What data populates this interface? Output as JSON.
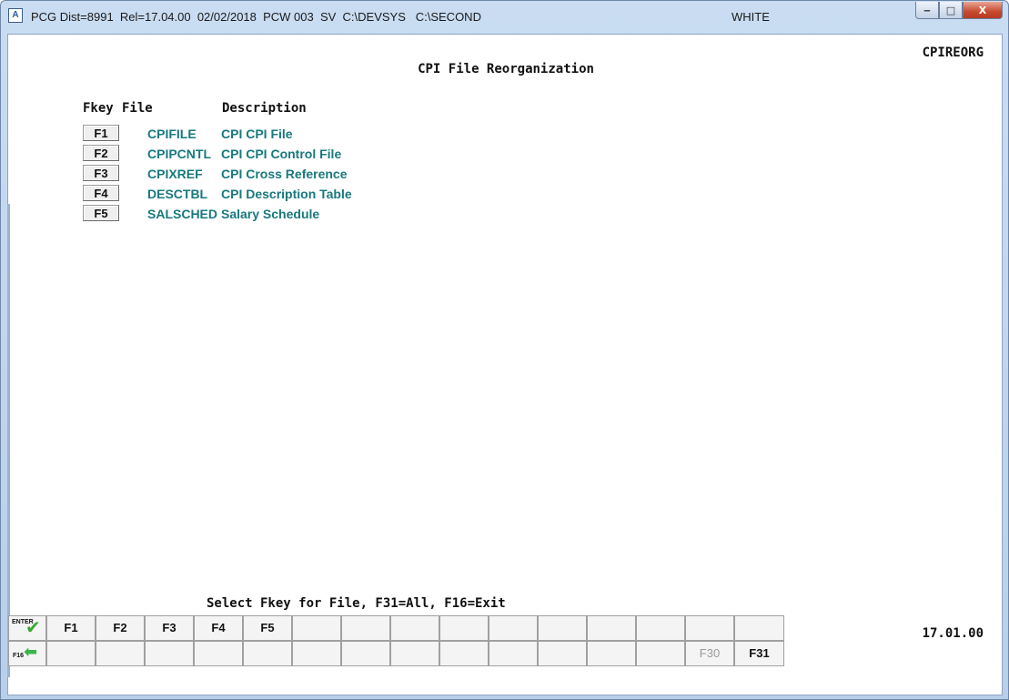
{
  "window": {
    "title": "PCG Dist=8991  Rel=17.04.00  02/02/2018  PCW 003  SV  C:\\DEVSYS   C:\\SECOND",
    "title_right": "WHITE",
    "app_icon": "A",
    "buttons": {
      "minimize": "‒",
      "maximize": "□",
      "close": "X"
    }
  },
  "screen": {
    "program_id": "CPIREORG",
    "title": "CPI File Reorganization",
    "headers": {
      "fkey": "Fkey",
      "file": "File",
      "description": "Description"
    },
    "rows": [
      {
        "key": "F1",
        "file": "CPIFILE",
        "description": "CPI CPI File"
      },
      {
        "key": "F2",
        "file": "CPIPCNTL",
        "description": "CPI CPI Control File"
      },
      {
        "key": "F3",
        "file": "CPIXREF",
        "description": "CPI Cross Reference"
      },
      {
        "key": "F4",
        "file": "DESCTBL",
        "description": "CPI Description Table"
      },
      {
        "key": "F5",
        "file": "SALSCHED",
        "description": "Salary Schedule"
      }
    ],
    "prompt": "Select Fkey for File, F31=All, F16=Exit",
    "version": "17.01.00"
  },
  "fkeys": {
    "enter_label": "ENTER",
    "f16_label": "F16",
    "row1": [
      "F1",
      "F2",
      "F3",
      "F4",
      "F5",
      "",
      "",
      "",
      "",
      "",
      "",
      "",
      "",
      "",
      ""
    ],
    "row2": [
      "",
      "",
      "",
      "",
      "",
      "",
      "",
      "",
      "",
      "",
      "",
      "",
      "",
      "F30",
      "F31"
    ]
  },
  "colors": {
    "link": "#18797d",
    "accent_green": "#3aa832"
  }
}
